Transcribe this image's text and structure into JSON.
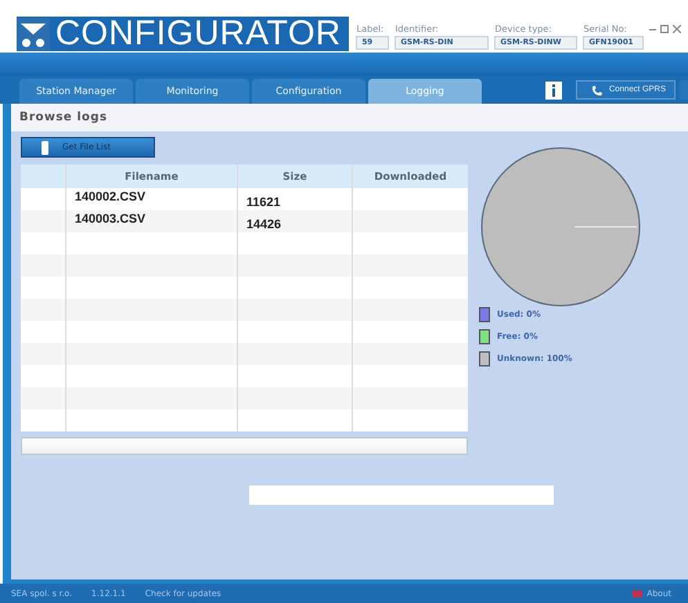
{
  "header": {
    "logo_text": "CONFIGURATOR",
    "fields": [
      {
        "label": "Label:",
        "value": "59"
      },
      {
        "label": "Identifier:",
        "value": "GSM-RS-DIN"
      },
      {
        "label": "Device type:",
        "value": "GSM-RS-DINW"
      },
      {
        "label": "Serial No:",
        "value": "GFN19001"
      }
    ]
  },
  "tabs": [
    {
      "label": "Station Manager",
      "selected": false
    },
    {
      "label": "Monitoring",
      "selected": false
    },
    {
      "label": "Configuration",
      "selected": false
    },
    {
      "label": "Logging",
      "selected": true
    }
  ],
  "connect_button": "Connect GPRS",
  "section_title": "Browse logs",
  "get_button": "Get File List",
  "table": {
    "columns": [
      "Filename",
      "Size",
      "Downloaded"
    ],
    "rows": [
      {
        "filename": "140002.CSV",
        "size": "11621"
      },
      {
        "filename": "140003.CSV",
        "size": "14426"
      }
    ]
  },
  "chart_data": {
    "type": "pie",
    "categories": [
      "Used: 0%",
      "Free: 0%",
      "Unknown: 100%"
    ],
    "values": [
      0,
      0,
      100
    ],
    "colors": [
      "#7a7ae6",
      "#7ee27e",
      "#bdbdbd"
    ]
  },
  "status_bar": {
    "company": "SEA spol. s r.o.",
    "version": "1.12.1.1",
    "update_link": "Check for updates",
    "about": "About"
  }
}
